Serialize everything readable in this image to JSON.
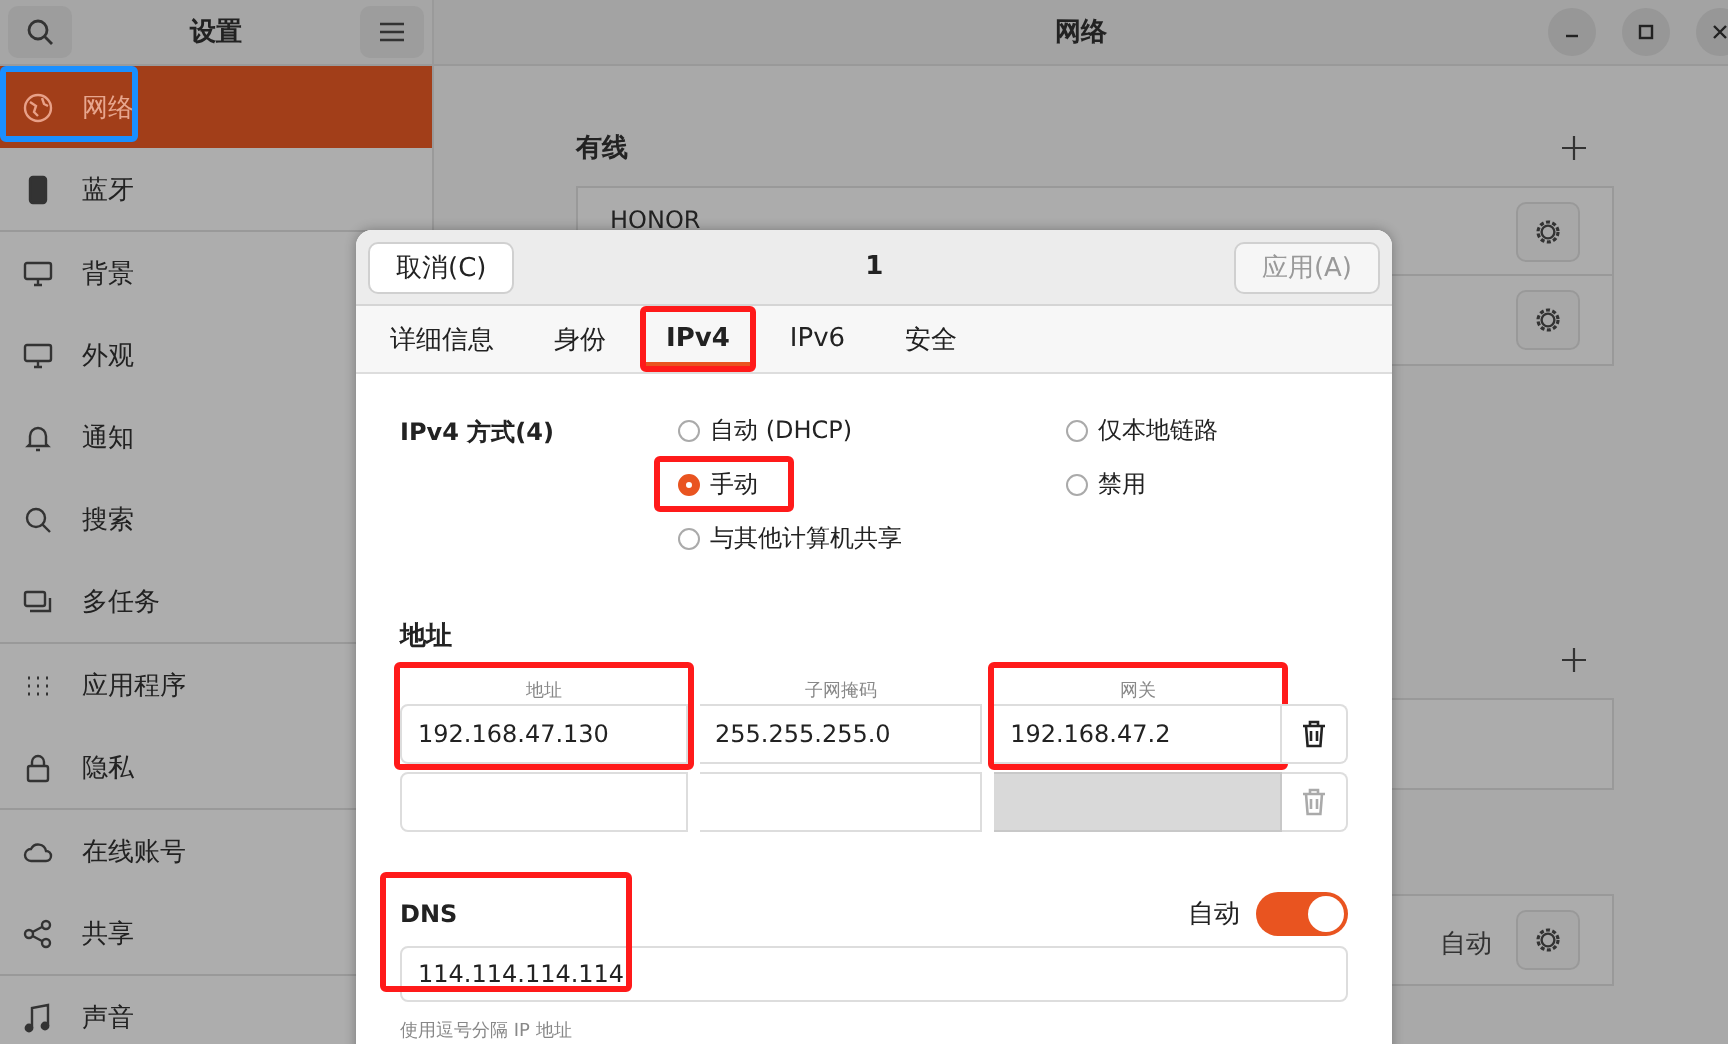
{
  "sidebar": {
    "title": "设置",
    "items": [
      {
        "label": "网络",
        "selected": true,
        "highlighted": true,
        "section_start": false
      },
      {
        "label": "蓝牙",
        "selected": false,
        "highlighted": false,
        "section_start": false
      },
      {
        "label": "背景",
        "selected": false,
        "highlighted": false,
        "section_start": true
      },
      {
        "label": "外观",
        "selected": false,
        "highlighted": false,
        "section_start": false
      },
      {
        "label": "通知",
        "selected": false,
        "highlighted": false,
        "section_start": false
      },
      {
        "label": "搜索",
        "selected": false,
        "highlighted": false,
        "section_start": false
      },
      {
        "label": "多任务",
        "selected": false,
        "highlighted": false,
        "section_start": false
      },
      {
        "label": "应用程序",
        "selected": false,
        "highlighted": false,
        "section_start": true
      },
      {
        "label": "隐私",
        "selected": false,
        "highlighted": false,
        "section_start": false
      },
      {
        "label": "在线账号",
        "selected": false,
        "highlighted": false,
        "section_start": true
      },
      {
        "label": "共享",
        "selected": false,
        "highlighted": false,
        "section_start": false
      },
      {
        "label": "声音",
        "selected": false,
        "highlighted": false,
        "section_start": true
      }
    ]
  },
  "main": {
    "title": "网络",
    "sections": [
      {
        "title": "有线",
        "rows": [
          {
            "label": "HONOR",
            "has_settings": true
          },
          {
            "has_settings": true
          }
        ]
      },
      {
        "rows": [
          {
            "has_settings": false
          }
        ]
      },
      {
        "rows": [
          {
            "status": "自动",
            "has_settings": true
          }
        ]
      }
    ]
  },
  "dialog": {
    "title": "1",
    "cancel": "取消(C)",
    "apply": {
      "label": "应用(A)",
      "disabled": true
    },
    "tabs": [
      {
        "label": "详细信息",
        "selected": false,
        "highlighted": false
      },
      {
        "label": "身份",
        "selected": false,
        "highlighted": false
      },
      {
        "label": "IPv4",
        "selected": true,
        "highlighted": true
      },
      {
        "label": "IPv6",
        "selected": false,
        "highlighted": false
      },
      {
        "label": "安全",
        "selected": false,
        "highlighted": false
      }
    ],
    "method_label": "IPv4 方式(4)",
    "methods": [
      {
        "label": "自动 (DHCP)",
        "selected": false,
        "highlighted": false
      },
      {
        "label": "仅本地链路",
        "selected": false,
        "highlighted": false
      },
      {
        "label": "手动",
        "selected": true,
        "highlighted": true
      },
      {
        "label": "禁用",
        "selected": false,
        "highlighted": false
      },
      {
        "label": "与其他计算机共享",
        "selected": false,
        "highlighted": false
      }
    ],
    "address_title": "地址",
    "address_columns": [
      {
        "label": "地址",
        "highlighted": true
      },
      {
        "label": "子网掩码",
        "highlighted": false
      },
      {
        "label": "网关",
        "highlighted": true
      }
    ],
    "address_rows": [
      {
        "cells": [
          {
            "value": "192.168.47.130",
            "disabled": false
          },
          {
            "value": "255.255.255.0",
            "disabled": false
          },
          {
            "value": "192.168.47.2",
            "disabled": false
          }
        ],
        "delete_disabled": false
      },
      {
        "cells": [
          {
            "disabled": false
          },
          {
            "disabled": false
          },
          {
            "disabled": true
          }
        ],
        "delete_disabled": true
      }
    ],
    "dns": {
      "title": "DNS",
      "highlighted": true,
      "auto_label": "自动",
      "auto_on": true,
      "value": "114.114.114.114",
      "hint": "使用逗号分隔 IP 地址"
    }
  }
}
